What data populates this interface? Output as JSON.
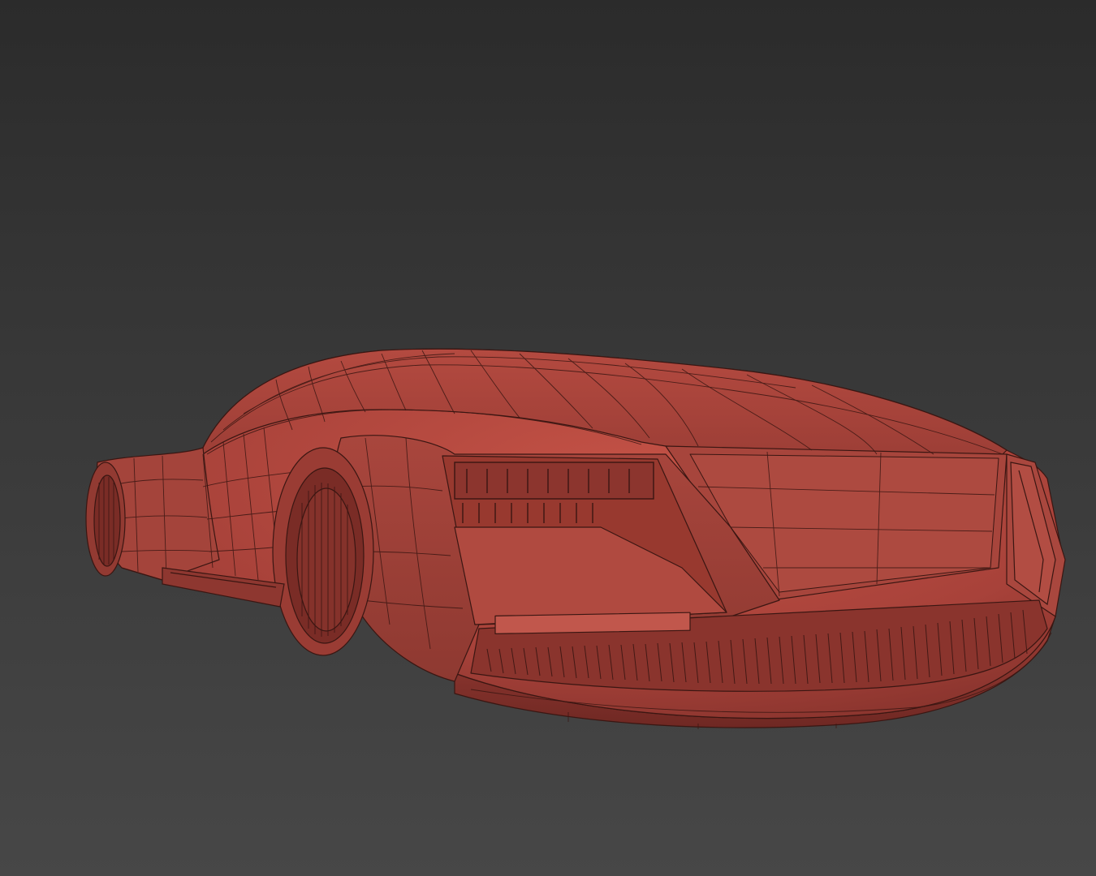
{
  "viewport": {
    "background_top": "#2b2b2b",
    "background_bottom": "#474747"
  },
  "model": {
    "description_icon": "wireframe-car-model",
    "shaded_color": "#b5463c",
    "wire_color": "#3a1612"
  }
}
